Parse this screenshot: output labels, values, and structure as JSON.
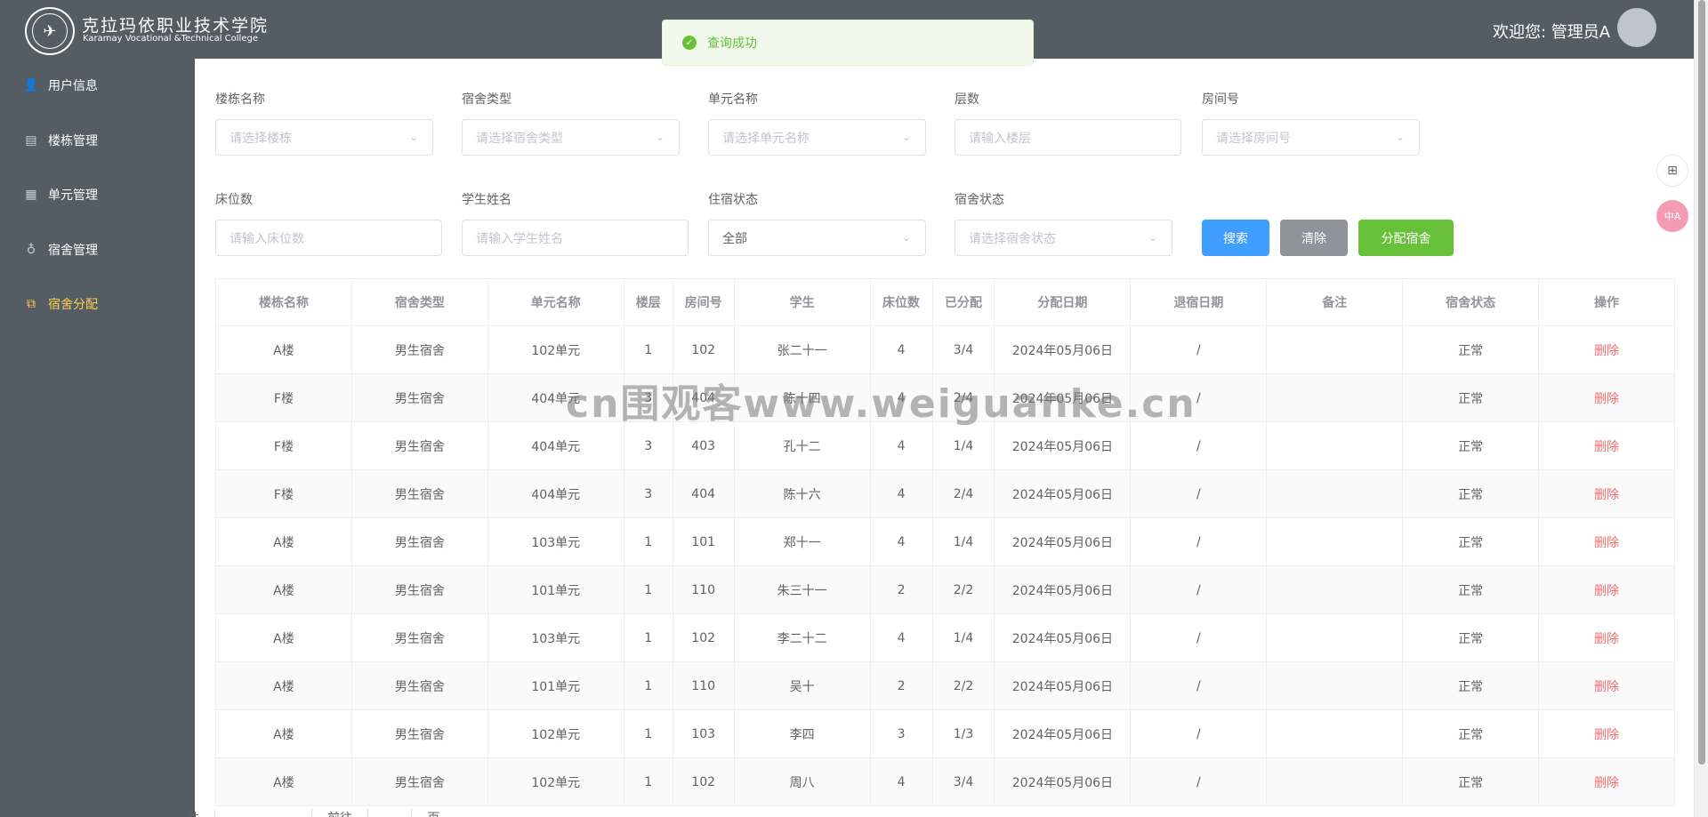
{
  "header": {
    "school_name_cn": "克拉玛依职业技术学院",
    "school_name_en": "Karamay Vocational &Technical College",
    "welcome": "欢迎您: 管理员A"
  },
  "toast": {
    "message": "查询成功"
  },
  "sidebar": {
    "items": [
      {
        "label": "用户信息",
        "icon": "user-icon"
      },
      {
        "label": "楼栋管理",
        "icon": "building-icon"
      },
      {
        "label": "单元管理",
        "icon": "unit-icon"
      },
      {
        "label": "宿舍管理",
        "icon": "bulb-icon"
      },
      {
        "label": "宿舍分配",
        "icon": "assign-icon",
        "active": true
      }
    ],
    "colors": {
      "background": "#545c64",
      "active": "#ffd04b"
    }
  },
  "filters": {
    "building": {
      "label": "楼栋名称",
      "placeholder": "请选择楼栋"
    },
    "dorm_type": {
      "label": "宿舍类型",
      "placeholder": "请选择宿舍类型"
    },
    "unit": {
      "label": "单元名称",
      "placeholder": "请选择单元名称"
    },
    "floor": {
      "label": "层数",
      "placeholder": "请输入楼层"
    },
    "room": {
      "label": "房间号",
      "placeholder": "请选择房间号"
    },
    "beds": {
      "label": "床位数",
      "placeholder": "请输入床位数"
    },
    "student": {
      "label": "学生姓名",
      "placeholder": "请输入学生姓名"
    },
    "stay_status": {
      "label": "住宿状态",
      "value": "全部"
    },
    "dorm_status": {
      "label": "宿舍状态",
      "placeholder": "请选择宿舍状态"
    }
  },
  "buttons": {
    "search": "搜索",
    "clear": "清除",
    "assign": "分配宿舍"
  },
  "table": {
    "headers": [
      "楼栋名称",
      "宿舍类型",
      "单元名称",
      "楼层",
      "房间号",
      "学生",
      "床位数",
      "已分配",
      "分配日期",
      "退宿日期",
      "备注",
      "宿舍状态",
      "操作"
    ],
    "rows": [
      [
        "A楼",
        "男生宿舍",
        "102单元",
        "1",
        "102",
        "张二十一",
        "4",
        "3/4",
        "2024年05月06日",
        "/",
        "",
        "正常",
        "删除"
      ],
      [
        "F楼",
        "男生宿舍",
        "404单元",
        "3",
        "404",
        "陈十四",
        "4",
        "2/4",
        "2024年05月06日",
        "/",
        "",
        "正常",
        "删除"
      ],
      [
        "F楼",
        "男生宿舍",
        "404单元",
        "3",
        "403",
        "孔十二",
        "4",
        "1/4",
        "2024年05月06日",
        "/",
        "",
        "正常",
        "删除"
      ],
      [
        "F楼",
        "男生宿舍",
        "404单元",
        "3",
        "404",
        "陈十六",
        "4",
        "2/4",
        "2024年05月06日",
        "/",
        "",
        "正常",
        "删除"
      ],
      [
        "A楼",
        "男生宿舍",
        "103单元",
        "1",
        "101",
        "郑十一",
        "4",
        "1/4",
        "2024年05月06日",
        "/",
        "",
        "正常",
        "删除"
      ],
      [
        "A楼",
        "男生宿舍",
        "101单元",
        "1",
        "110",
        "朱三十一",
        "2",
        "2/2",
        "2024年05月06日",
        "/",
        "",
        "正常",
        "删除"
      ],
      [
        "A楼",
        "男生宿舍",
        "103单元",
        "1",
        "102",
        "李二十二",
        "4",
        "1/4",
        "2024年05月06日",
        "/",
        "",
        "正常",
        "删除"
      ],
      [
        "A楼",
        "男生宿舍",
        "101单元",
        "1",
        "110",
        "吴十",
        "2",
        "2/2",
        "2024年05月06日",
        "/",
        "",
        "正常",
        "删除"
      ],
      [
        "A楼",
        "男生宿舍",
        "102单元",
        "1",
        "103",
        "李四",
        "3",
        "1/3",
        "2024年05月06日",
        "/",
        "",
        "正常",
        "删除"
      ],
      [
        "A楼",
        "男生宿舍",
        "102单元",
        "1",
        "102",
        "周八",
        "4",
        "3/4",
        "2024年05月06日",
        "/",
        "",
        "正常",
        "删除"
      ]
    ]
  },
  "watermark": "cn围观客www.weiguanke.cn",
  "pager": {
    "total_label": "共",
    "prefix": "前往",
    "suffix": "页"
  },
  "float": {
    "grid": "grid-icon",
    "translate": "translate-icon",
    "translate_text": "中A"
  }
}
